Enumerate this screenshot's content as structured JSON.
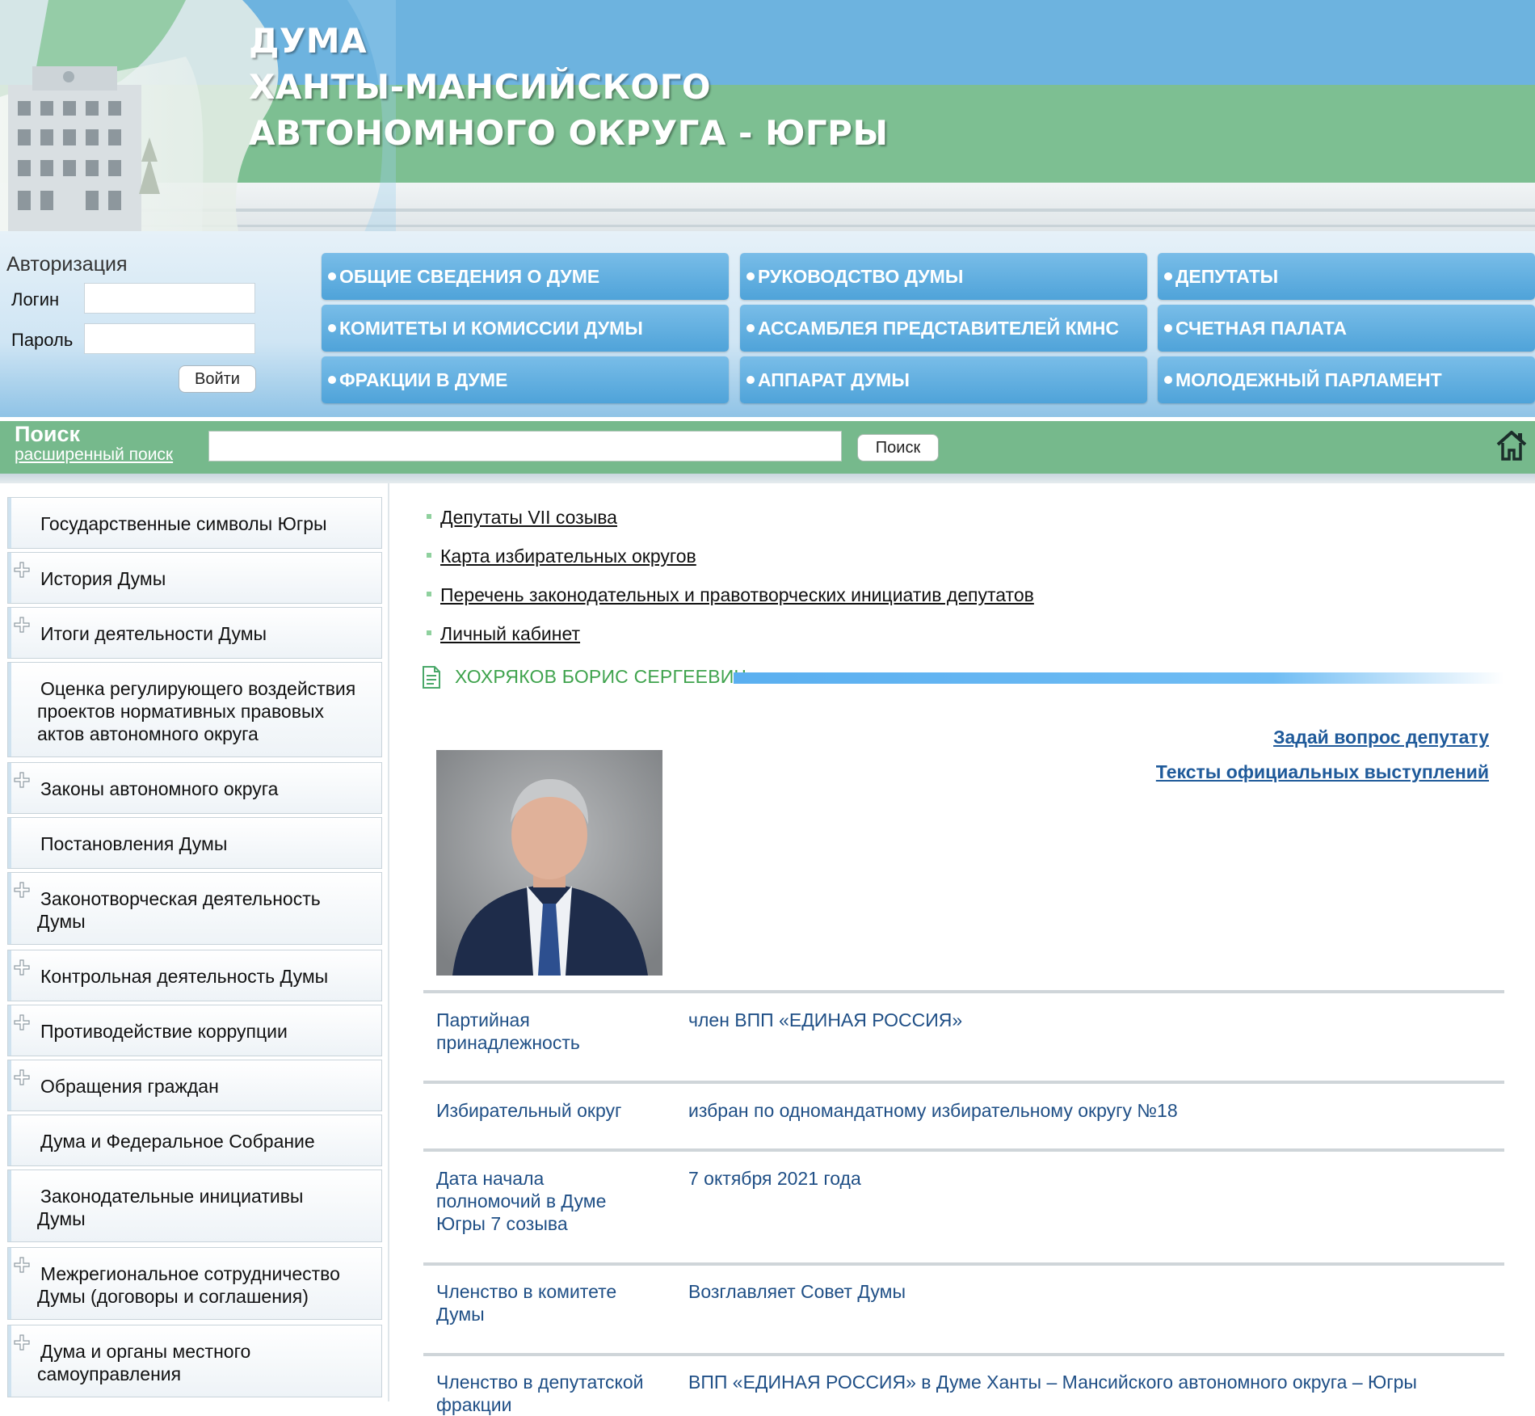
{
  "banner": {
    "title_line1": "ДУМА",
    "title_line2": "ХАНТЫ-МАНСИЙСКОГО",
    "title_line3": "АВТОНОМНОГО ОКРУГА - ЮГРЫ"
  },
  "auth": {
    "title": "Авторизация",
    "login_label": "Логин",
    "password_label": "Пароль",
    "login_value": "",
    "password_value": "",
    "submit_label": "Войти"
  },
  "nav": [
    "ОБЩИЕ СВЕДЕНИЯ О ДУМЕ",
    "РУКОВОДСТВО ДУМЫ",
    "ДЕПУТАТЫ",
    "КОМИТЕТЫ И КОМИССИИ ДУМЫ",
    "АССАМБЛЕЯ ПРЕДСТАВИТЕЛЕЙ КМНС",
    "СЧЕТНАЯ ПАЛАТА",
    "ФРАКЦИИ В ДУМЕ",
    "АППАРАТ ДУМЫ",
    "МОЛОДЕЖНЫЙ ПАРЛАМЕНТ"
  ],
  "search": {
    "title": "Поиск",
    "advanced_label": "расширенный поиск",
    "query": "",
    "button_label": "Поиск"
  },
  "sidebar": [
    {
      "label": "Государственные символы Югры",
      "expandable": false
    },
    {
      "label": "История Думы",
      "expandable": true
    },
    {
      "label": "Итоги деятельности Думы",
      "expandable": true
    },
    {
      "label_lines": [
        "Оценка регулирующего воздействия",
        "проектов нормативных правовых",
        "актов автономного округа"
      ],
      "expandable": false
    },
    {
      "label": "Законы автономного округа",
      "expandable": true
    },
    {
      "label": "Постановления Думы",
      "expandable": false
    },
    {
      "label_lines": [
        "Законотворческая деятельность",
        "Думы"
      ],
      "expandable": true
    },
    {
      "label": "Контрольная деятельность Думы",
      "expandable": true
    },
    {
      "label": "Противодействие коррупции",
      "expandable": true
    },
    {
      "label": "Обращения граждан",
      "expandable": true
    },
    {
      "label": "Дума и Федеральное Собрание",
      "expandable": false
    },
    {
      "label_lines": [
        "Законодательные инициативы",
        "Думы"
      ],
      "expandable": false
    },
    {
      "label_lines": [
        "Межрегиональное сотрудничество",
        "Думы (договоры и соглашения)"
      ],
      "expandable": true
    },
    {
      "label_lines": [
        "Дума и органы местного",
        "самоуправления"
      ],
      "expandable": true
    }
  ],
  "main": {
    "links": [
      "Депутаты VII созыва",
      "Карта избирательных округов",
      "Перечень законодательных и правотворческих инициатив депутатов",
      "Личный кабинет"
    ],
    "deputy_name": "ХОХРЯКОВ БОРИС СЕРГЕЕВИЧ",
    "ask_question": "Задай вопрос депутату",
    "speeches": "Тексты официальных выступлений",
    "info": [
      {
        "label_lines": [
          "Партийная",
          "принадлежность"
        ],
        "value": "член ВПП «ЕДИНАЯ РОССИЯ»"
      },
      {
        "label_lines": [
          "Избирательный округ"
        ],
        "value": "избран по одномандатному избирательному округу №18"
      },
      {
        "label_lines": [
          "Дата начала",
          "полномочий в Думе",
          "Югры 7 созыва"
        ],
        "value": "7 октября 2021 года"
      },
      {
        "label_lines": [
          "Членство в комитете",
          "Думы"
        ],
        "value": "Возглавляет Совет Думы"
      },
      {
        "label_lines": [
          "Членство в депутатской",
          "фракции"
        ],
        "value": "ВПП «ЕДИНАЯ РОССИЯ» в Думе Ханты – Мансийского автономного округа – Югры"
      }
    ]
  },
  "colors": {
    "banner_blue": "#6db3df",
    "banner_green": "#7dbf92",
    "nav_blue": "#4fa3d9",
    "search_green": "#76b98c",
    "link_blue": "#1f5a9a",
    "deputy_green": "#3fa34d"
  }
}
